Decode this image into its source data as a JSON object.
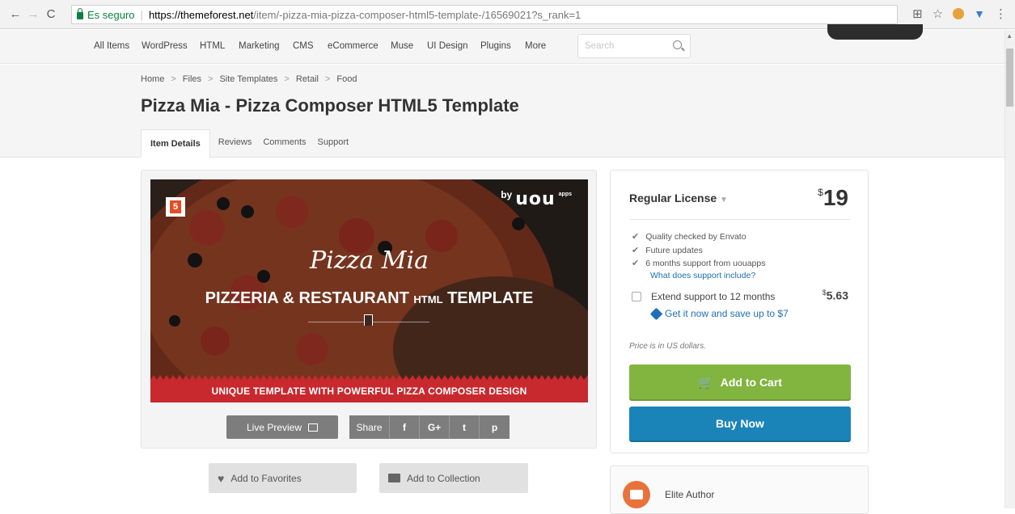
{
  "browser": {
    "secure_label": "Es seguro",
    "url_host": "https://themeforest.net",
    "url_path": "/item/-pizza-mia-pizza-composer-html5-template-/16569021?s_rank=1"
  },
  "site_nav": {
    "items": [
      "All Items",
      "WordPress",
      "HTML",
      "Marketing",
      "CMS",
      "eCommerce",
      "Muse",
      "UI Design",
      "Plugins",
      "More"
    ],
    "search_placeholder": "Search"
  },
  "breadcrumb": [
    "Home",
    "Files",
    "Site Templates",
    "Retail",
    "Food"
  ],
  "page_title": "Pizza Mia - Pizza Composer HTML5 Template",
  "tabs": [
    "Item Details",
    "Reviews",
    "Comments",
    "Support"
  ],
  "banner": {
    "html5_badge": "5",
    "by_text": "by",
    "logo_text": "uou",
    "logo_sup": "apps",
    "brand": "Pizza Mia",
    "tagline_main": "PIZZERIA & RESTAURANT",
    "tagline_small": "HTML",
    "tagline_end": "TEMPLATE",
    "strip": "UNIQUE TEMPLATE WITH POWERFUL PIZZA COMPOSER DESIGN"
  },
  "preview_actions": {
    "live_preview": "Live Preview",
    "share": "Share",
    "facebook": "f",
    "googleplus": "G+",
    "twitter": "t",
    "pinterest": "p"
  },
  "collect_actions": {
    "favorites": "Add to Favorites",
    "collection": "Add to Collection"
  },
  "purchase": {
    "license": "Regular License",
    "currency_symbol": "$",
    "price": "19",
    "features": [
      "Quality checked by Envato",
      "Future updates",
      "6 months support from uouapps"
    ],
    "support_link": "What does support include?",
    "extend_label": "Extend support to 12 months",
    "extend_price": "5.63",
    "save_link": "Get it now and save up to $7",
    "usd_note": "Price is in US dollars.",
    "add_to_cart": "Add to Cart",
    "buy_now": "Buy Now"
  },
  "author": {
    "badge": "Elite Author"
  },
  "colors": {
    "cart_green": "#82b440",
    "buy_blue": "#1a84b8",
    "link_blue": "#1e6fb8",
    "banner_red": "#c8292e"
  }
}
